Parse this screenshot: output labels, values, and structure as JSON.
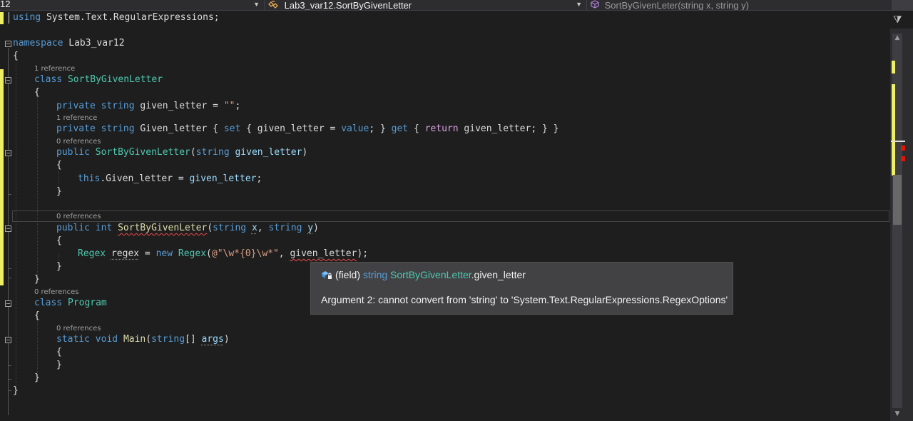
{
  "navbar": {
    "project_partial": "12",
    "type_context": "Lab3_var12.SortByGivenLetter",
    "member_context": "SortByGivenLeter(string x, string y)",
    "dropdown_glyph": "▼",
    "type_icon": "class-icon",
    "member_icon": "method-icon"
  },
  "code": {
    "l01_using": "using",
    "l01_rest": " System.Text.RegularExpressions;",
    "l03_namespace": "namespace",
    "l03_name": " Lab3_var12",
    "l04_brace": "{",
    "lens_1ref_a": "1 reference",
    "l05_class": "class",
    "l05_name": "SortByGivenLetter",
    "l06_brace": "{",
    "l07_private": "private",
    "l07_string": "string",
    "l07_field": " given_letter = ",
    "l07_value": "\"\"",
    "l07_semi": ";",
    "lens_1ref_b": "1 reference",
    "l08_private": "private",
    "l08_string": "string",
    "l08_prop": " Given_letter { ",
    "l08_set": "set",
    "l08_mid1": " { given_letter = ",
    "l08_value": "value",
    "l08_mid2": "; } ",
    "l08_get": "get",
    "l08_mid3": " { ",
    "l08_return": "return",
    "l08_end": " given_letter; } }",
    "lens_0ref_a": "0 references",
    "l09_public": "public",
    "l09_ctor": "SortByGivenLetter",
    "l09_open": "(",
    "l09_string": "string",
    "l09_param": " given_letter",
    "l09_close": ")",
    "l10_brace": "{",
    "l11_this": "this",
    "l11_mid": ".Given_letter = ",
    "l11_param": "given_letter",
    "l11_semi": ";",
    "l12_brace": "}",
    "lens_0ref_b": "0 references",
    "l14_public": "public",
    "l14_int": "int",
    "l14_method": "SortByGivenLeter",
    "l14_open": "(",
    "l14_string1": "string",
    "l14_x": "x",
    "l14_comma": ", ",
    "l14_string2": "string",
    "l14_y": "y",
    "l14_close": ")",
    "l15_brace": "{",
    "l16_regex": "Regex",
    "l16_var": "regex",
    "l16_eq": " = ",
    "l16_new": "new",
    "l16_regex2": "Regex",
    "l16_open": "(",
    "l16_str": "@\"\\w*{0}\\w*\"",
    "l16_comma": ", ",
    "l16_arg": "given_letter",
    "l16_end": ");",
    "l17_brace": "}",
    "l18_brace": "}",
    "lens_0ref_c": "0 references",
    "l19_class": "class",
    "l19_name": "Program",
    "l20_brace": "{",
    "lens_0ref_d": "0 references",
    "l21_static": "static",
    "l21_void": "void",
    "l21_main": "Main",
    "l21_open": "(",
    "l21_string": "string",
    "l21_arr": "[] ",
    "l21_args": "args",
    "l21_close": ")",
    "l22_brace": "{",
    "l23_brace": "}",
    "l24_brace": "}",
    "l25_brace": "}"
  },
  "tooltip": {
    "prefix": "(field) ",
    "type_kw": "string",
    "class_name": "SortByGivenLetter",
    "member": ".given_letter",
    "icon": "field-icon",
    "error": "Argument 2: cannot convert from 'string' to 'System.Text.RegularExpressions.RegexOptions'"
  },
  "colors": {
    "background": "#1e1e1e",
    "keyword": "#569cd6",
    "type": "#4ec9b0",
    "string": "#d69d85",
    "parameter": "#9cdcfe",
    "error_squiggle": "#f14c4c",
    "change_marker": "#efef64"
  },
  "icons": {
    "split": "⧩",
    "scroll_up": "▲",
    "scroll_down": "▼"
  }
}
